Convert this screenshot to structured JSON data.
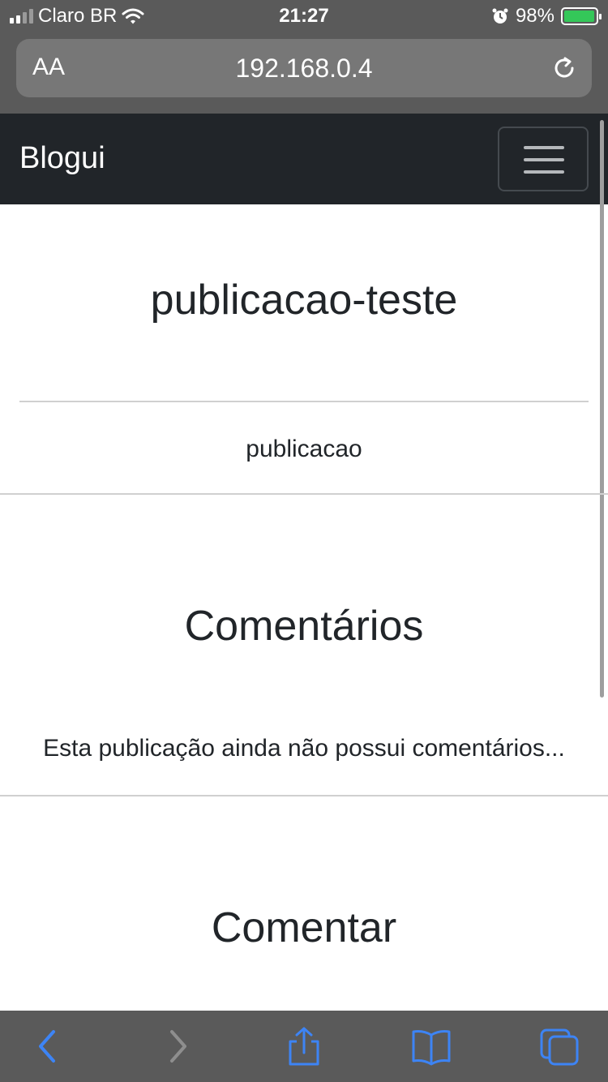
{
  "status_bar": {
    "carrier": "Claro BR",
    "time": "21:27",
    "battery": "98%",
    "battery_level": 0.98,
    "icons": [
      "signal-icon",
      "wifi-icon",
      "alarm-icon",
      "battery-charging-icon"
    ]
  },
  "browser": {
    "text_size_label": "AA",
    "url": "192.168.0.4",
    "reload_icon": "reload-icon"
  },
  "navbar": {
    "brand": "Blogui",
    "menu_icon": "hamburger-icon"
  },
  "post": {
    "title": "publicacao-teste",
    "body": "publicacao"
  },
  "comments": {
    "heading": "Comentários",
    "empty_message": "Esta publicação ainda não possui comentários..."
  },
  "comment_form": {
    "heading": "Comentar"
  },
  "toolbar": {
    "icons": [
      "back-icon",
      "forward-icon",
      "share-icon",
      "bookmarks-icon",
      "tabs-icon"
    ],
    "accent_color": "#3d84f5",
    "disabled_color": "#8e8e8e"
  }
}
